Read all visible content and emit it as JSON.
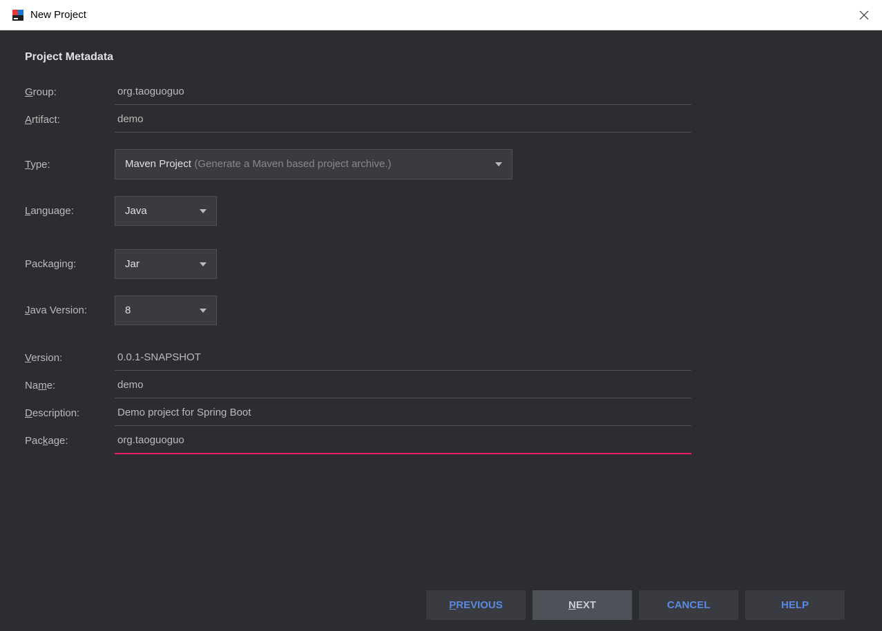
{
  "titlebar": {
    "title": "New Project"
  },
  "section": {
    "heading": "Project Metadata"
  },
  "labels": {
    "group": "roup:",
    "group_m": "G",
    "artifact": "rtifact:",
    "artifact_m": "A",
    "type": "ype:",
    "type_m": "T",
    "language": "anguage:",
    "language_m": "L",
    "packaging": "Packa",
    "packaging_m": "g",
    "packaging_rest": "ing:",
    "java_version": "ava Version:",
    "java_version_m": "J",
    "version": "ersion:",
    "version_m": "V",
    "name": "Na",
    "name_m": "m",
    "name_rest": "e:",
    "description": "escription:",
    "description_m": "D",
    "package": "Pac",
    "package_m": "k",
    "package_rest": "age:"
  },
  "fields": {
    "group": "org.taoguoguo",
    "artifact": "demo",
    "version": "0.0.1-SNAPSHOT",
    "name": "demo",
    "description": "Demo project for Spring Boot",
    "package": "org.taoguoguo"
  },
  "dropdowns": {
    "type": {
      "value": "Maven Project",
      "hint": "(Generate a Maven based project archive.)"
    },
    "language": {
      "value": "Java"
    },
    "packaging": {
      "value": "Jar"
    },
    "java_version": {
      "value": "8"
    }
  },
  "buttons": {
    "previous": "REVIOUS",
    "previous_m": "P",
    "next": "EXT",
    "next_m": "N",
    "cancel": "CANCEL",
    "help": "HELP"
  }
}
